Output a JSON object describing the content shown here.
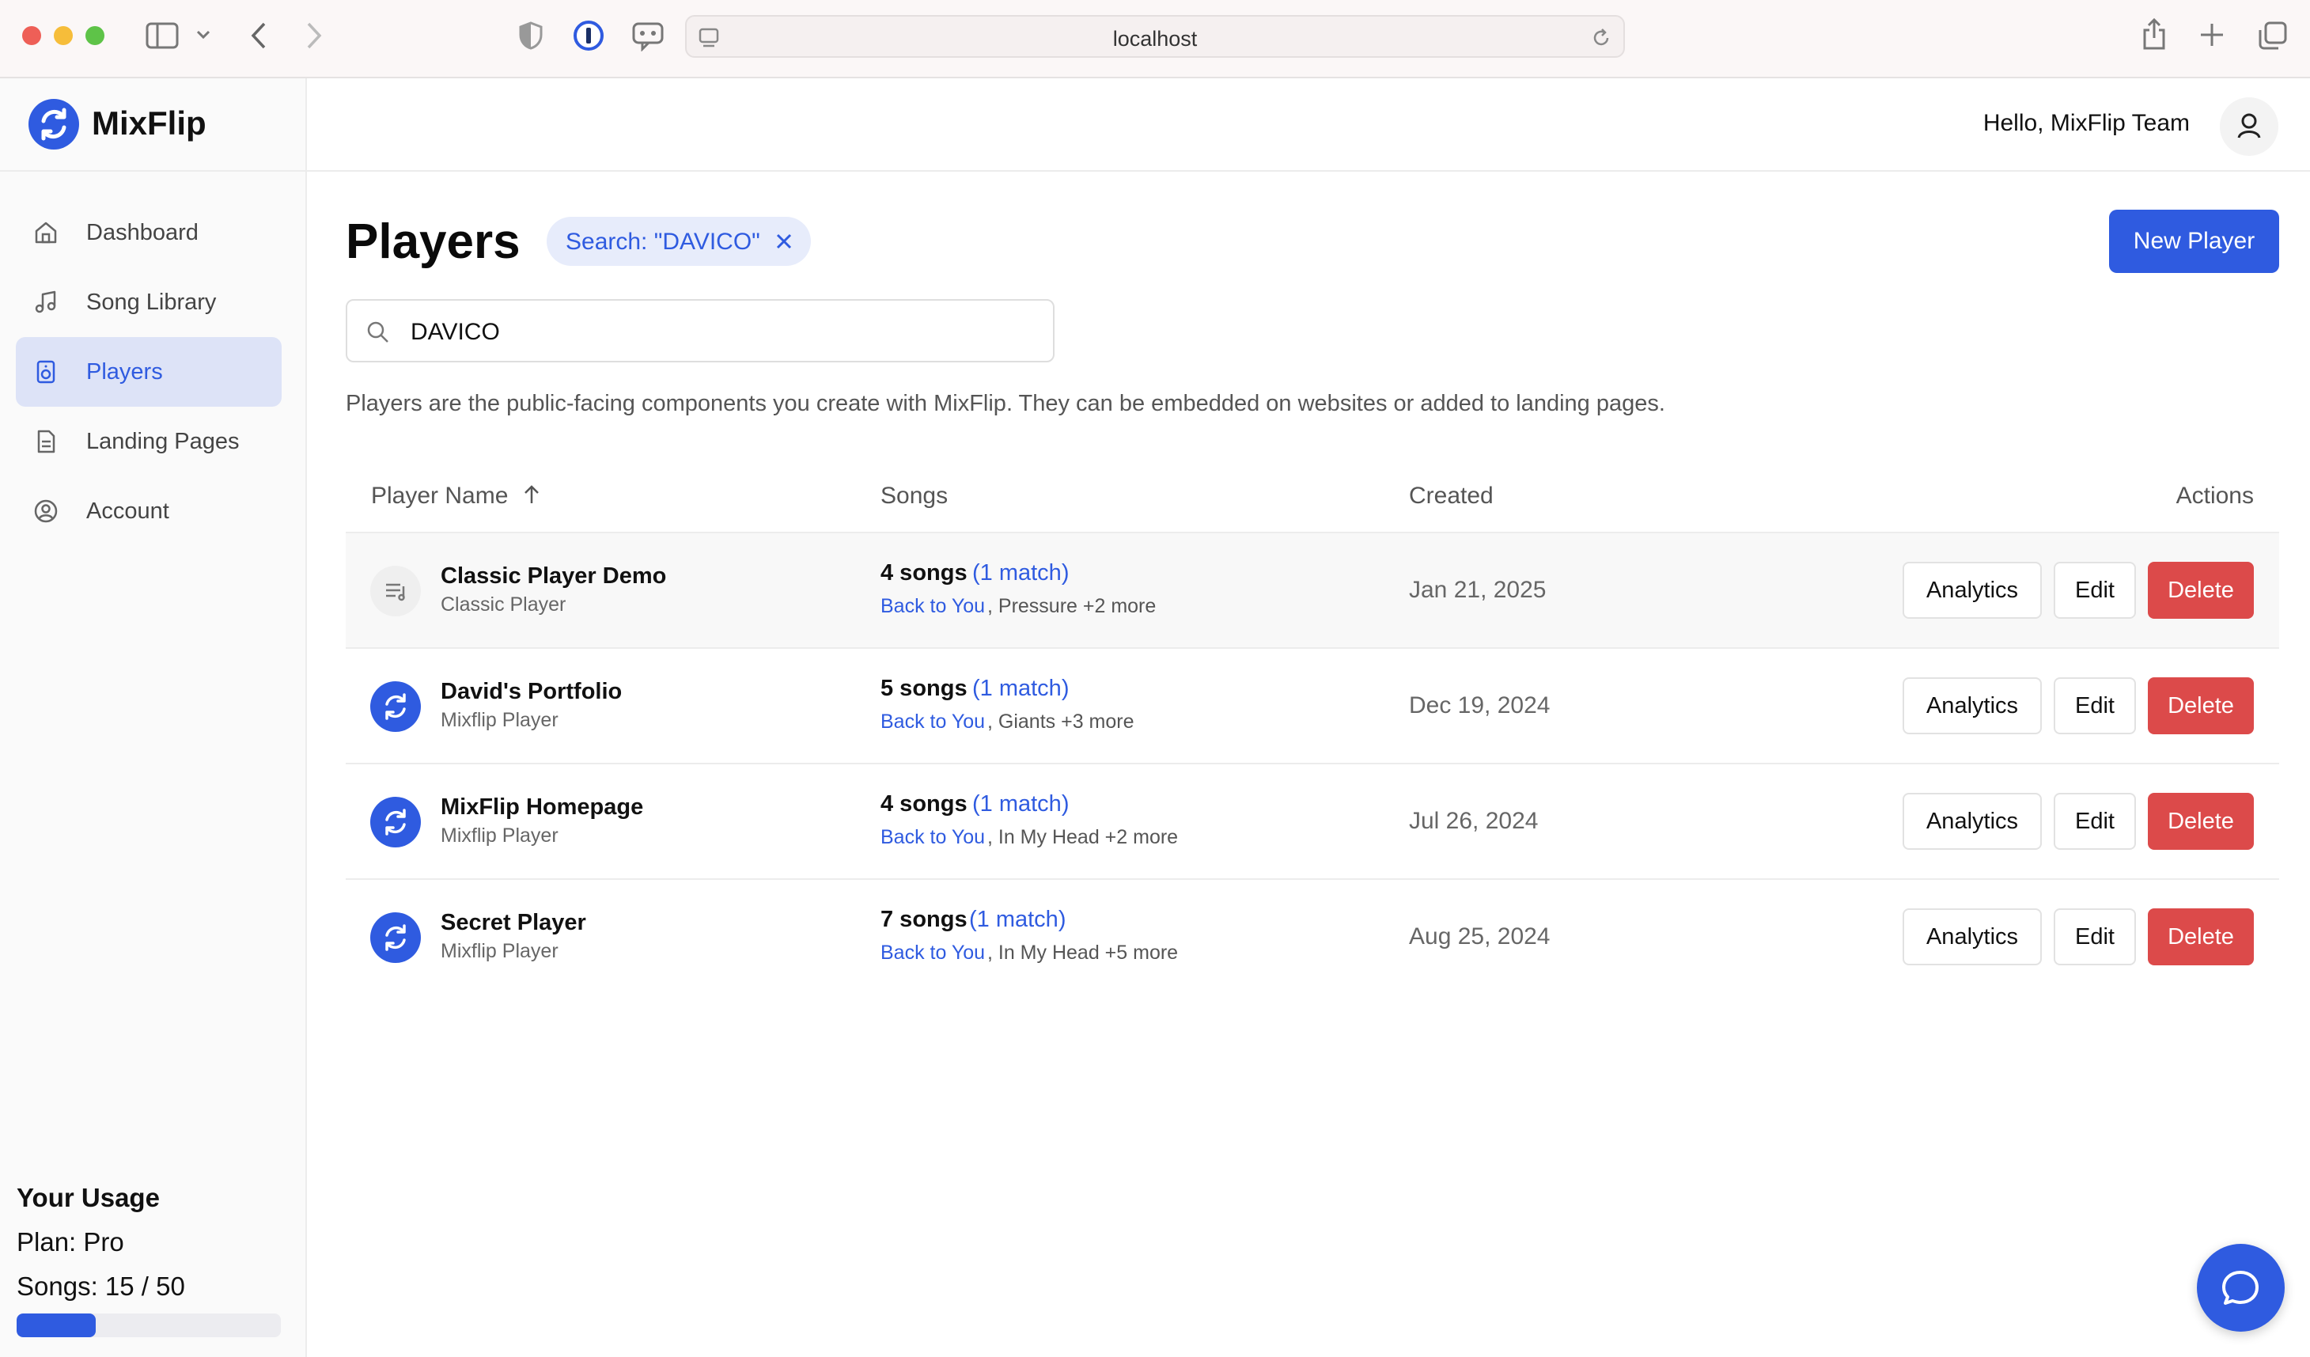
{
  "browser": {
    "url": "localhost"
  },
  "app": {
    "name": "MixFlip",
    "greeting": "Hello, MixFlip Team"
  },
  "sidebar": {
    "items": [
      {
        "label": "Dashboard",
        "icon": "home-icon",
        "active": false
      },
      {
        "label": "Song Library",
        "icon": "music-note-icon",
        "active": false
      },
      {
        "label": "Players",
        "icon": "speaker-icon",
        "active": true
      },
      {
        "label": "Landing Pages",
        "icon": "document-icon",
        "active": false
      },
      {
        "label": "Account",
        "icon": "user-circle-icon",
        "active": false
      }
    ],
    "usage": {
      "title": "Your Usage",
      "plan": "Plan: Pro",
      "songs": "Songs: 15 / 50",
      "songs_used": 15,
      "songs_limit": 50
    }
  },
  "page": {
    "title": "Players",
    "search_chip": "Search: \"DAVICO\"",
    "new_button": "New Player",
    "search_value": "DAVICO",
    "description": "Players are the public-facing components you create with MixFlip. They can be embedded on websites or added to landing pages."
  },
  "table": {
    "headers": {
      "name": "Player Name",
      "songs": "Songs",
      "created": "Created",
      "actions": "Actions"
    },
    "rows": [
      {
        "name": "Classic Player Demo",
        "type": "Classic Player",
        "songs": "4 songs",
        "match": "(1 match)",
        "first_song": "Back to You",
        "rest": ", Pressure +2 more",
        "created": "Jan 21, 2025",
        "icon": "playlist-icon"
      },
      {
        "name": "David's Portfolio",
        "type": "Mixflip Player",
        "songs": "5 songs",
        "match": "(1 match)",
        "first_song": "Back to You",
        "rest": ", Giants +3 more",
        "created": "Dec 19, 2024",
        "icon": "mixflip-logo-icon"
      },
      {
        "name": "MixFlip Homepage",
        "type": "Mixflip Player",
        "songs": "4 songs",
        "match": "(1 match)",
        "first_song": "Back to You",
        "rest": ", In My Head +2 more",
        "created": "Jul 26, 2024",
        "icon": "mixflip-logo-icon"
      },
      {
        "name": "Secret Player",
        "type": "Mixflip Player",
        "songs": "7 songs",
        "match": "(1 match)",
        "first_song": "Back to You",
        "rest": ", In My Head +5 more",
        "created": "Aug 25, 2024",
        "icon": "mixflip-logo-icon"
      }
    ],
    "actions": {
      "analytics": "Analytics",
      "edit": "Edit",
      "delete": "Delete"
    }
  },
  "colors": {
    "accent": "#2f5be0",
    "danger": "#dc4a4a",
    "active_nav_bg": "#dde3f7"
  }
}
